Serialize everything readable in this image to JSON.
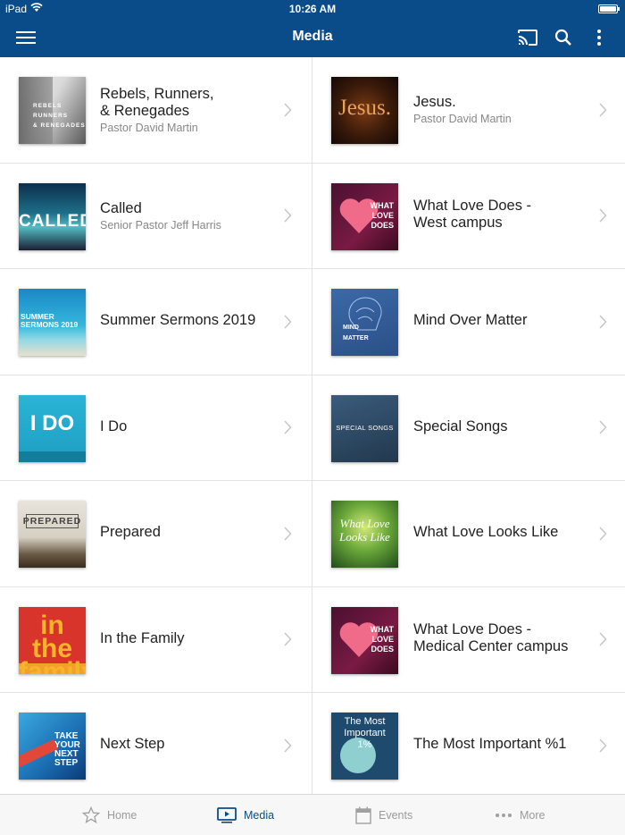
{
  "status_bar": {
    "device": "iPad",
    "time": "10:26 AM"
  },
  "nav": {
    "title": "Media",
    "left_icon": "hamburger-menu-icon",
    "right_icons": [
      "cast-icon",
      "search-icon",
      "more-vertical-icon"
    ]
  },
  "items": [
    {
      "title": "Rebels, Runners,\n& Renegades",
      "subtitle": "Pastor David Martin",
      "thumb_text": "REBELS\nRUNNERS\n& RENEGADES"
    },
    {
      "title": "Jesus.",
      "subtitle": "Pastor David Martin",
      "thumb_text": "Jesus."
    },
    {
      "title": "Called",
      "subtitle": "Senior Pastor Jeff Harris",
      "thumb_text": "CALLED"
    },
    {
      "title": "What Love Does -\nWest campus",
      "subtitle": "",
      "thumb_text": "WHAT\nLOVE\nDOES"
    },
    {
      "title": "Summer Sermons 2019",
      "subtitle": "",
      "thumb_text": "SUMMER\nSERMONS 2019"
    },
    {
      "title": "Mind Over Matter",
      "subtitle": "",
      "thumb_text": "MIND\nMATTER"
    },
    {
      "title": "I Do",
      "subtitle": "",
      "thumb_text": "I DO"
    },
    {
      "title": "Special Songs",
      "subtitle": "",
      "thumb_text": "SPECIAL SONGS"
    },
    {
      "title": "Prepared",
      "subtitle": "",
      "thumb_text": "PREPARED"
    },
    {
      "title": "What Love Looks Like",
      "subtitle": "",
      "thumb_text": "What Love\nLooks Like"
    },
    {
      "title": "In the Family",
      "subtitle": "",
      "thumb_text": "in\nthe family"
    },
    {
      "title": "What Love Does -\nMedical Center campus",
      "subtitle": "",
      "thumb_text": "WHAT\nLOVE\nDOES"
    },
    {
      "title": "Next Step",
      "subtitle": "",
      "thumb_text": "TAKE\nYOUR\nNEXT\nSTEP"
    },
    {
      "title": "The Most Important %1",
      "subtitle": "",
      "thumb_text": "The Most\nImportant\n1%"
    }
  ],
  "tabs": [
    {
      "label": "Home",
      "icon": "star-icon",
      "active": false
    },
    {
      "label": "Media",
      "icon": "play-screen-icon",
      "active": true
    },
    {
      "label": "Events",
      "icon": "calendar-icon",
      "active": false
    },
    {
      "label": "More",
      "icon": "more-horizontal-icon",
      "active": false
    }
  ],
  "colors": {
    "brand": "#0a4c8a",
    "divider": "#e4e4e4",
    "tab_inactive": "#9a9a9a"
  }
}
